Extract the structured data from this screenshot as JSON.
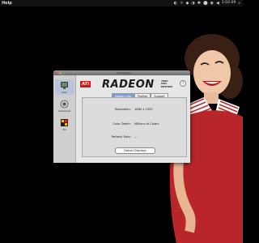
{
  "menubar": {
    "app_name": "Help",
    "clock": "1:02:09",
    "extras": [
      "◐",
      "☼",
      "◆",
      "◑",
      "✱",
      "⬤",
      "◉",
      "◀",
      "⌕"
    ]
  },
  "window": {
    "title": "ATI Displays",
    "sidebar": [
      {
        "label": "Info",
        "icon": "display-info-icon",
        "selected": true
      },
      {
        "label": "Advanced",
        "icon": "advanced-icon",
        "selected": false
      },
      {
        "label": "3D",
        "icon": "3d-icon",
        "selected": false
      }
    ],
    "brand": {
      "logo": "ATi",
      "product": "RADEON",
      "model_lines": [
        "7000",
        "MAC",
        "EDITION"
      ]
    },
    "help_label": "?",
    "tabs": [
      {
        "label": "Display Info",
        "active": true
      },
      {
        "label": "Profiles",
        "active": false
      },
      {
        "label": "Support",
        "active": false
      }
    ],
    "info": {
      "resolution_label": "Resolution:",
      "resolution_value": "1680 x 1050",
      "color_depth_label": "Color Depth:",
      "color_depth_value": "Millions of Colors",
      "refresh_label": "Refresh Rate:",
      "refresh_value": "--"
    },
    "detect_button": "Detect Displays"
  },
  "colors": {
    "ati_red": "#d11111",
    "tab_active": "#7a9cd0",
    "desktop": "#000000"
  }
}
